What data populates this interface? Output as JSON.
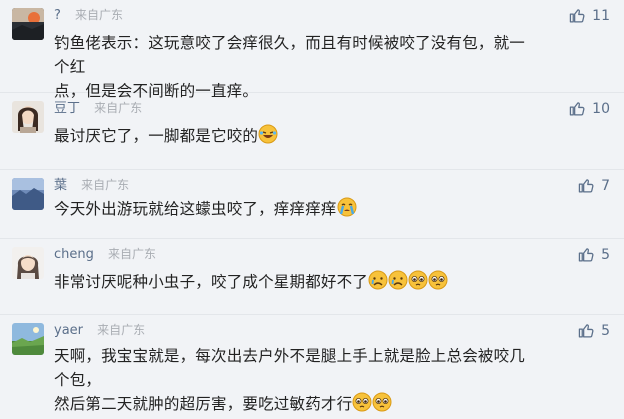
{
  "comments": [
    {
      "nick": "?",
      "location": "来自广东",
      "text_lines": [
        "钓鱼佬表示：这玩意咬了会痒很久，而且有时候被咬了没有包，就一个红",
        "点，但是会不间断的一直痒。"
      ],
      "likes": "11"
    },
    {
      "nick": "豆丁",
      "location": "来自广东",
      "text": "最讨厌它了，一脚都是它咬的",
      "likes": "10"
    },
    {
      "nick": "葉",
      "location": "来自广东",
      "text": "今天外出游玩就给这蠓虫咬了，痒痒痒痒",
      "likes": "7"
    },
    {
      "nick": "cheng",
      "location": "来自广东",
      "text": "非常讨厌呢种小虫子，咬了成个星期都好不了",
      "likes": "5"
    },
    {
      "nick": "yaer",
      "location": "来自广东",
      "text_lines": [
        "天啊，我宝宝就是，每次出去户外不是腿上手上就是脸上总会被咬几个包，",
        "然后第二天就肿的超厉害，要吃过敏药才行"
      ],
      "likes": "5"
    }
  ]
}
